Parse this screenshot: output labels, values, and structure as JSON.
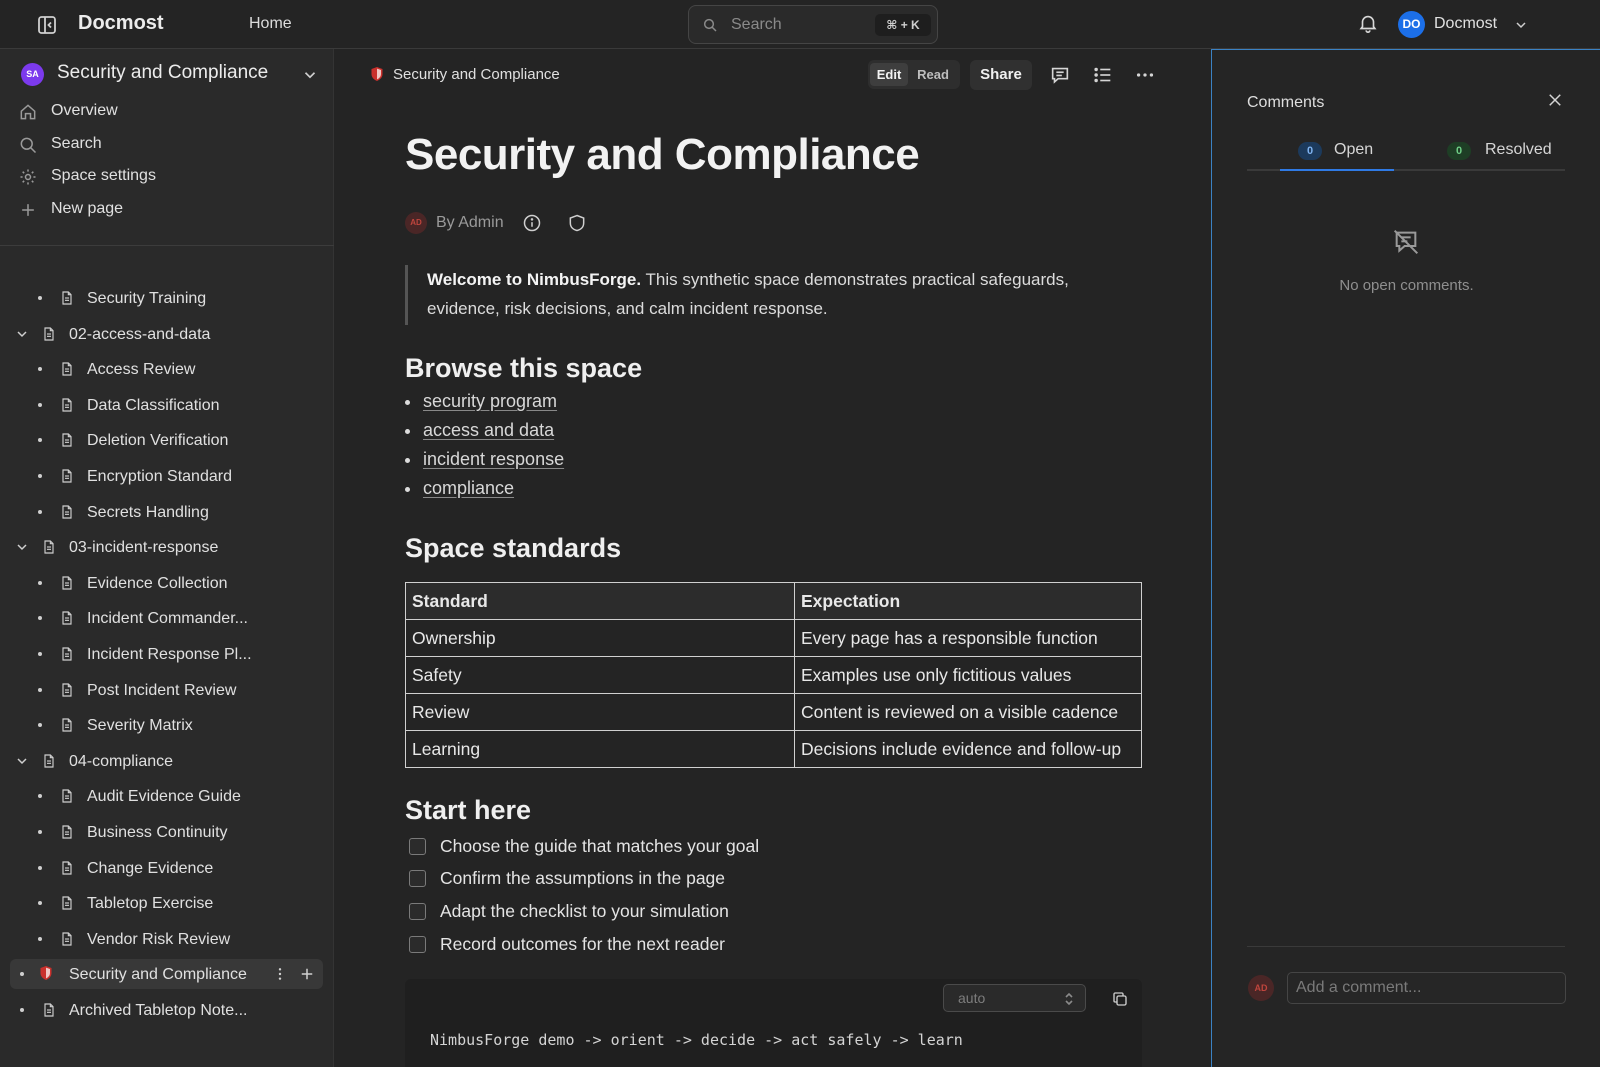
{
  "header": {
    "brand": "Docmost",
    "home_label": "Home",
    "search_placeholder": "Search",
    "search_shortcut": "⌘ + K",
    "user_initials": "DO",
    "user_name": "Docmost",
    "accent_color": "#1c6fe8"
  },
  "sidebar": {
    "space_initials": "SA",
    "space_name": "Security and Compliance",
    "nav": [
      {
        "label": "Overview",
        "icon": "home-icon"
      },
      {
        "label": "Search",
        "icon": "search-icon"
      },
      {
        "label": "Space settings",
        "icon": "gear-icon"
      },
      {
        "label": "New page",
        "icon": "plus-icon"
      }
    ],
    "tree": [
      {
        "label": "Security Training",
        "level": 2,
        "kind": "page"
      },
      {
        "label": "02-access-and-data",
        "level": 1,
        "kind": "folder"
      },
      {
        "label": "Access Review",
        "level": 2,
        "kind": "page"
      },
      {
        "label": "Data Classification",
        "level": 2,
        "kind": "page"
      },
      {
        "label": "Deletion Verification",
        "level": 2,
        "kind": "page"
      },
      {
        "label": "Encryption Standard",
        "level": 2,
        "kind": "page"
      },
      {
        "label": "Secrets Handling",
        "level": 2,
        "kind": "page"
      },
      {
        "label": "03-incident-response",
        "level": 1,
        "kind": "folder"
      },
      {
        "label": "Evidence Collection",
        "level": 2,
        "kind": "page"
      },
      {
        "label": "Incident Commander...",
        "level": 2,
        "kind": "page"
      },
      {
        "label": "Incident Response Pl...",
        "level": 2,
        "kind": "page"
      },
      {
        "label": "Post Incident Review",
        "level": 2,
        "kind": "page"
      },
      {
        "label": "Severity Matrix",
        "level": 2,
        "kind": "page"
      },
      {
        "label": "04-compliance",
        "level": 1,
        "kind": "folder"
      },
      {
        "label": "Audit Evidence Guide",
        "level": 2,
        "kind": "page"
      },
      {
        "label": "Business Continuity",
        "level": 2,
        "kind": "page"
      },
      {
        "label": "Change Evidence",
        "level": 2,
        "kind": "page"
      },
      {
        "label": "Tabletop Exercise",
        "level": 2,
        "kind": "page"
      },
      {
        "label": "Vendor Risk Review",
        "level": 2,
        "kind": "page"
      },
      {
        "label": "Security and Compliance",
        "level": 1,
        "kind": "active"
      },
      {
        "label": "Archived Tabletop Note...",
        "level": 1,
        "kind": "root-page"
      }
    ]
  },
  "toolbar": {
    "breadcrumb": "Security and Compliance",
    "edit_label": "Edit",
    "read_label": "Read",
    "share_label": "Share"
  },
  "page": {
    "title": "Security and Compliance",
    "author_initials": "AD",
    "byline": "By Admin",
    "callout_bold": "Welcome to NimbusForge.",
    "callout_text": " This synthetic space demonstrates practical safeguards, evidence, risk decisions, and calm incident response.",
    "browse_heading": "Browse this space",
    "links": [
      "security program",
      "access and data",
      "incident response",
      "compliance"
    ],
    "standards_heading": "Space standards",
    "table": {
      "headers": [
        "Standard",
        "Expectation"
      ],
      "rows": [
        [
          "Ownership",
          "Every page has a responsible function"
        ],
        [
          "Safety",
          "Examples use only fictitious values"
        ],
        [
          "Review",
          "Content is reviewed on a visible cadence"
        ],
        [
          "Learning",
          "Decisions include evidence and follow-up"
        ]
      ]
    },
    "start_heading": "Start here",
    "tasks": [
      "Choose the guide that matches your goal",
      "Confirm the assumptions in the page",
      "Adapt the checklist to your simulation",
      "Record outcomes for the next reader"
    ],
    "code_language": "auto",
    "code_text": "NimbusForge demo -> orient -> decide -> act safely -> learn"
  },
  "comments": {
    "title": "Comments",
    "open_count": "0",
    "open_label": "Open",
    "resolved_count": "0",
    "resolved_label": "Resolved",
    "empty_text": "No open comments.",
    "user_initials": "AD",
    "input_placeholder": "Add a comment..."
  }
}
